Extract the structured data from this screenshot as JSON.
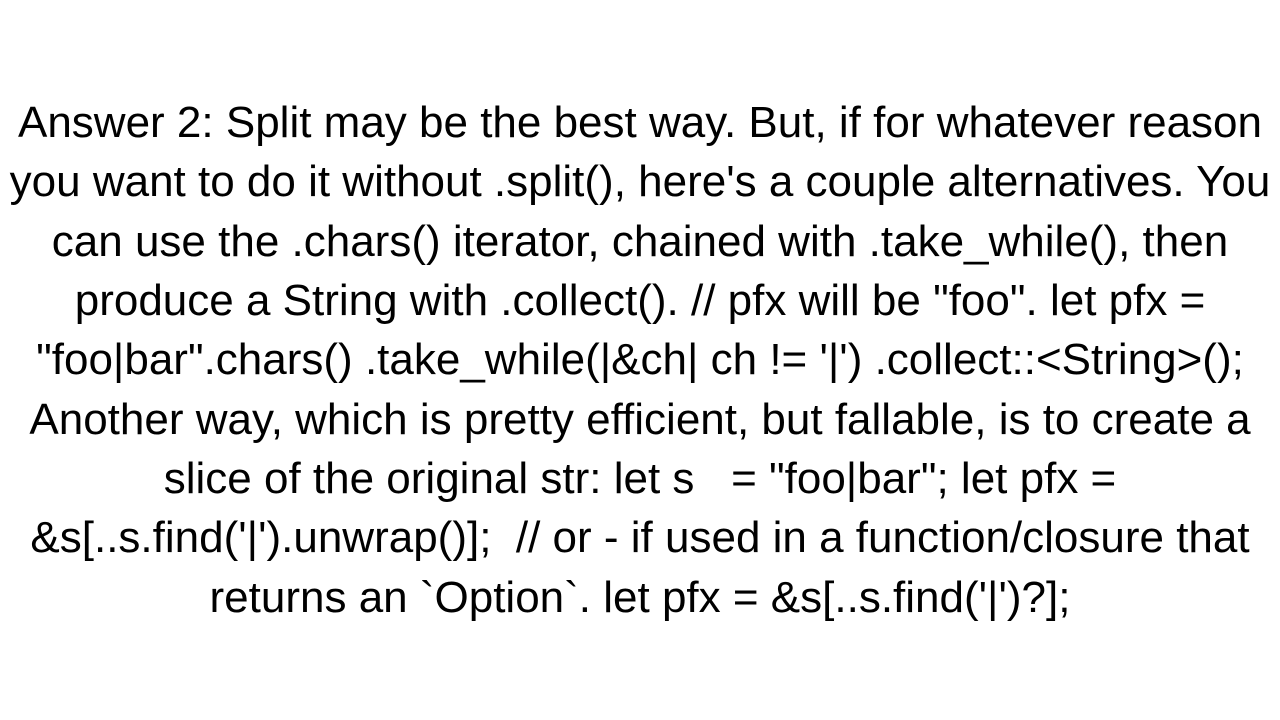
{
  "answer": {
    "label": "Answer 2:",
    "intro": "Split may be the best way. But, if for whatever reason you want to do it without .split(), here's a couple alternatives. You can use the .chars() iterator, chained with .take_while(), then produce a String with .collect().",
    "code1_comment": "// pfx will be \"foo\".",
    "code1_line1": "let pfx = \"foo|bar\".chars()",
    "code1_line2": ".take_while(|&ch| ch != '|')",
    "code1_line3": ".collect::<String>();",
    "mid": "Another way, which is pretty efficient, but fallable, is to create a slice of the original str:",
    "code2_line1": "let s   = \"foo|bar\";",
    "code2_line2": "let pfx = &s[..s.find('|').unwrap()];",
    "code2_comment": "// or - if used in a function/closure that returns an `Option`.",
    "code2_line3": "let pfx = &s[..s.find('|')?];"
  }
}
